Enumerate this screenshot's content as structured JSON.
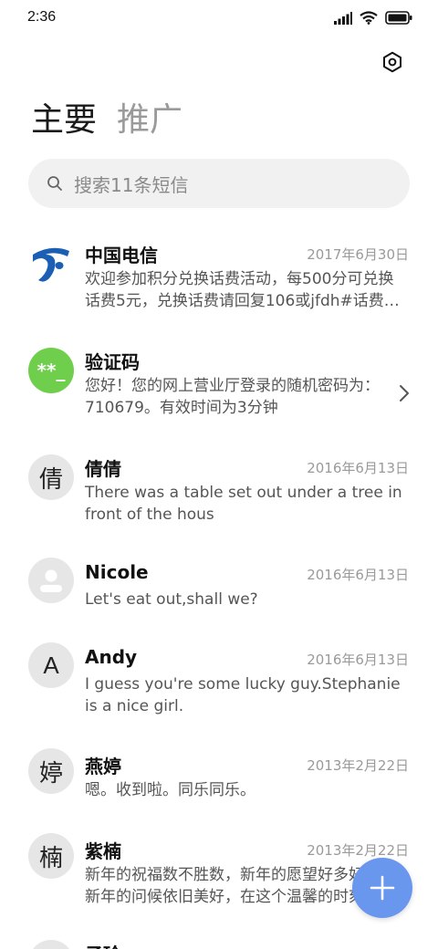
{
  "status_bar": {
    "time": "2:36"
  },
  "tabs": [
    {
      "label": "主要",
      "active": true
    },
    {
      "label": "推广",
      "active": false
    }
  ],
  "search": {
    "placeholder": "搜索11条短信"
  },
  "colors": {
    "fab": "#6a97ee",
    "verify_avatar": "#6fcf4c",
    "telecom_blue": "#1a5fb4"
  },
  "messages": [
    {
      "name": "中国电信",
      "date": "2017年6月30日",
      "preview_line1": "欢迎参加积分兑换话费活动，每500分可兑换",
      "preview_line2": "话费5元，兑换话费请回复106或jfdh#话费…",
      "avatar": "china-telecom-logo-icon"
    },
    {
      "name": "验证码",
      "date": "",
      "preview_line1": "您好！您的网上营业厅登录的随机密码为：",
      "preview_line2": "710679。有效时间为3分钟",
      "avatar_text": "**_"
    },
    {
      "name": "倩倩",
      "date": "2016年6月13日",
      "preview_line1": "There was a table set out under a tree in",
      "preview_line2": "front of the hous",
      "avatar_text": "倩"
    },
    {
      "name": "Nicole",
      "date": "2016年6月13日",
      "preview_line1": "Let's eat out,shall we?",
      "preview_line2": "",
      "avatar": "person-icon"
    },
    {
      "name": "Andy",
      "date": "2016年6月13日",
      "preview_line1": "I guess you're some lucky guy.Stephanie",
      "preview_line2": "is a nice girl.",
      "avatar_text": "A"
    },
    {
      "name": "燕婷",
      "date": "2013年2月22日",
      "preview_line1": "嗯。收到啦。同乐同乐。",
      "preview_line2": "",
      "avatar_text": "婷"
    },
    {
      "name": "紫楠",
      "date": "2013年2月22日",
      "preview_line1": "新年的祝福数不胜数，新年的愿望好多好多，",
      "preview_line2": "新年的问候依旧美好，在这个温馨的时刻，",
      "avatar_text": "楠"
    },
    {
      "name": "子玲",
      "date": "",
      "preview_line1": "",
      "preview_line2": "",
      "avatar_text": ""
    }
  ]
}
